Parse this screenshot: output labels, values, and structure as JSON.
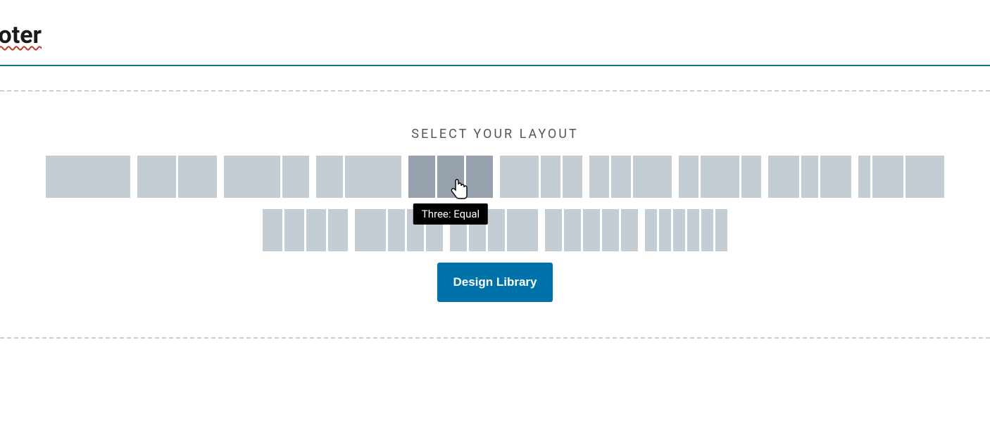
{
  "page": {
    "title_fragment": "Footer"
  },
  "heading": "SELECT YOUR LAYOUT",
  "tooltip": "Three: Equal",
  "button": "Design Library",
  "icons": {
    "cursor": "pointer-cursor-icon"
  }
}
